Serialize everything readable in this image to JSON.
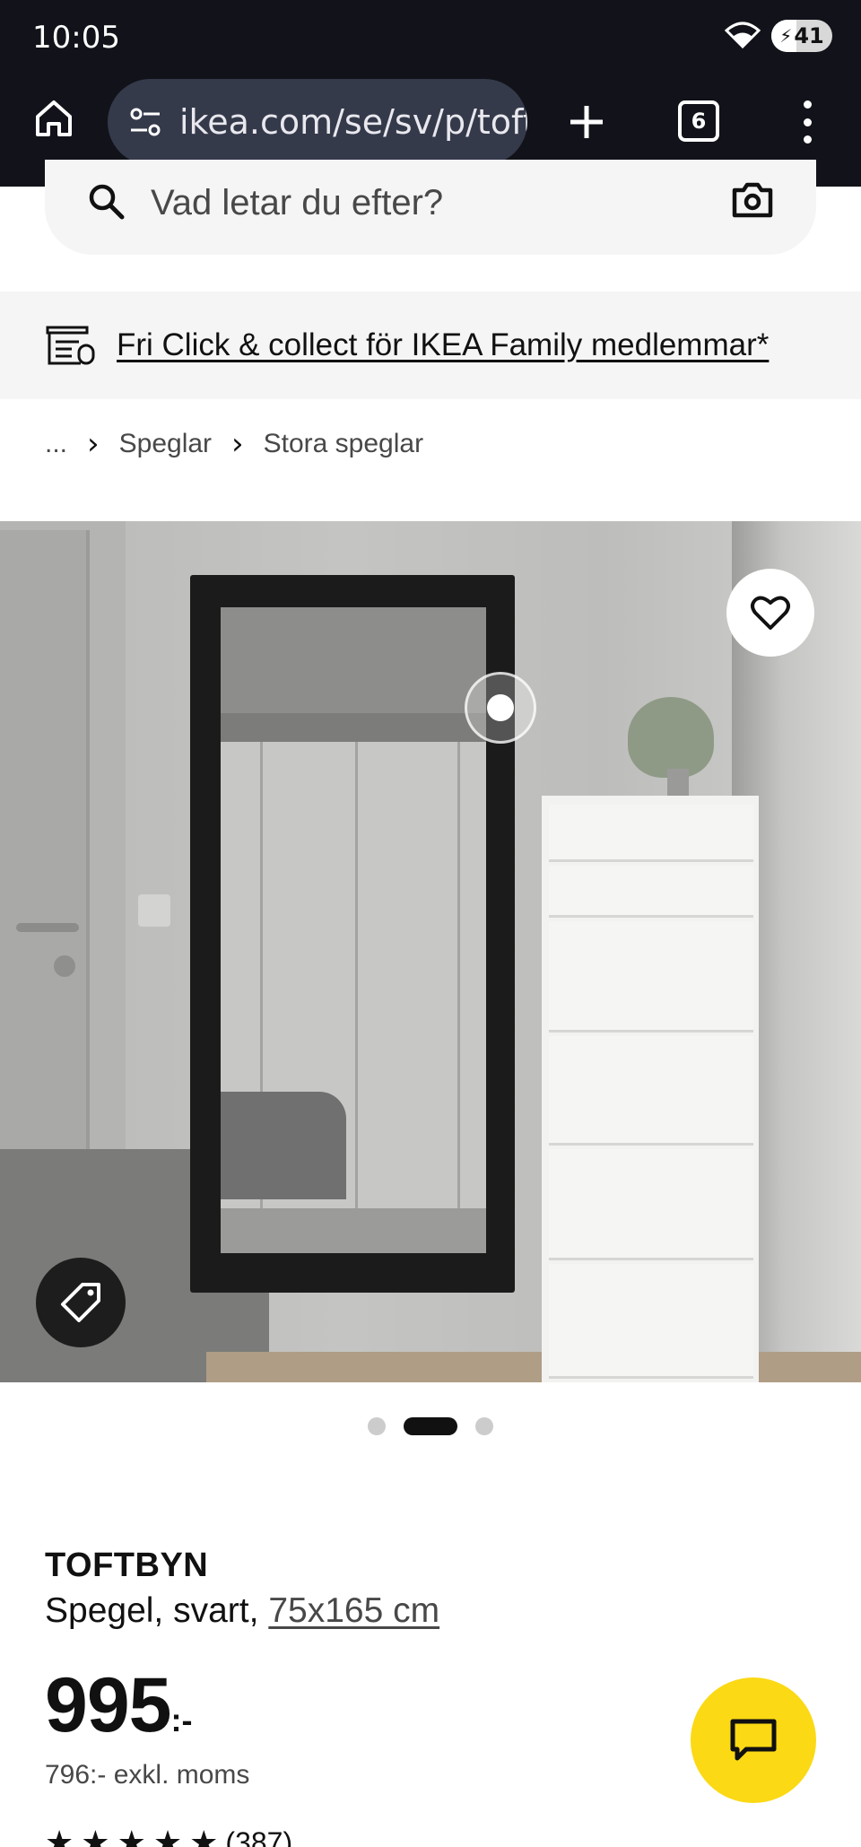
{
  "status_bar": {
    "time": "10:05",
    "battery": "41",
    "battery_level": 0.41,
    "icons": [
      "wifi-icon",
      "battery-charging-icon"
    ]
  },
  "browser": {
    "url": "ikea.com/se/sv/p/toft",
    "tab_count": "6",
    "icons": [
      "home-icon",
      "site-settings-icon",
      "new-tab-icon",
      "tabs-icon",
      "more-menu-icon"
    ]
  },
  "search": {
    "placeholder": "Vad letar du efter?",
    "icons": [
      "search-icon",
      "camera-icon"
    ]
  },
  "promo": {
    "text": "Fri Click & collect för IKEA Family medlemmar*",
    "icon": "store-pickup-icon"
  },
  "breadcrumb": {
    "items": [
      "...",
      "Speglar",
      "Stora speglar"
    ]
  },
  "gallery": {
    "active_index": 1,
    "count": 3,
    "icons": [
      "heart-icon",
      "tag-icon"
    ]
  },
  "product": {
    "name": "TOFTBYN",
    "description": "Spegel, svart,",
    "size": "75x165 cm",
    "price": "995",
    "price_suffix": ":-",
    "price_excl": "796:- exkl. moms",
    "rating_count": "(387)"
  },
  "chat": {
    "icon": "chat-icon",
    "color": "#fbd914"
  }
}
